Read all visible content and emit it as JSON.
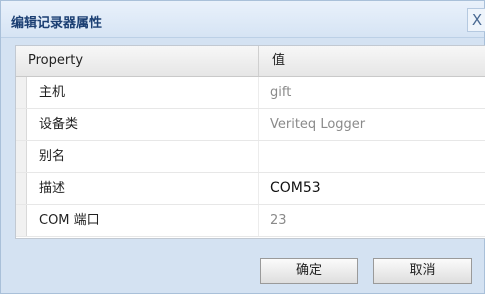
{
  "dialog": {
    "title": "编辑记录器属性",
    "close_label": "X"
  },
  "grid": {
    "columns": [
      "Property",
      "值"
    ],
    "rows": [
      {
        "name": "主机",
        "value": "gift",
        "editable": false
      },
      {
        "name": "设备类",
        "value": "Veriteq Logger",
        "editable": false
      },
      {
        "name": "别名",
        "value": "",
        "editable": true
      },
      {
        "name": "描述",
        "value": "COM53",
        "editable": true
      },
      {
        "name": "COM 端口",
        "value": "23",
        "editable": false
      }
    ]
  },
  "buttons": {
    "ok_label": "确定",
    "cancel_label": "取消"
  },
  "colors": {
    "title_text": "#1b3f73",
    "dialog_bg": "#d4e2f2",
    "readonly_text": "#8a8a8a"
  }
}
